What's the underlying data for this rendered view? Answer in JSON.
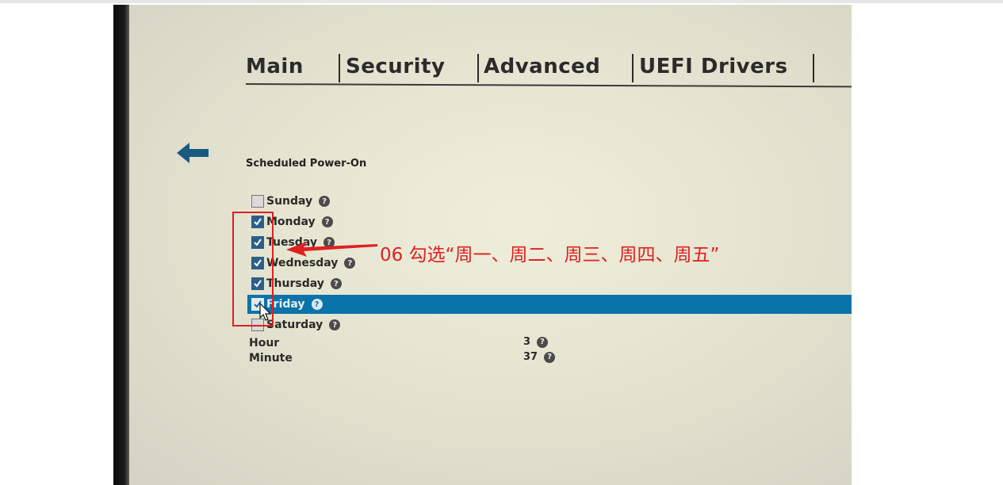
{
  "tabs": [
    {
      "label": "Main"
    },
    {
      "label": "Security"
    },
    {
      "label": "Advanced"
    },
    {
      "label": "UEFI Drivers"
    }
  ],
  "section_title": "Scheduled Power-On",
  "days": [
    {
      "label": "Sunday",
      "checked": false
    },
    {
      "label": "Monday",
      "checked": true
    },
    {
      "label": "Tuesday",
      "checked": true
    },
    {
      "label": "Wednesday",
      "checked": true
    },
    {
      "label": "Thursday",
      "checked": true
    },
    {
      "label": "Friday",
      "checked": true,
      "selected": true
    },
    {
      "label": "Saturday",
      "checked": false
    }
  ],
  "fields": {
    "hour": {
      "label": "Hour",
      "value": "3"
    },
    "minute": {
      "label": "Minute",
      "value": "37"
    }
  },
  "annotation": {
    "text": "06 勾选“周一、周二、周三、周四、周五”",
    "color": "#e02020"
  },
  "colors": {
    "highlight": "#0a73a9",
    "accent_arrow": "#1a5a80"
  },
  "icons": {
    "back": "back-arrow-icon",
    "help": "help-icon",
    "check": "checkmark-icon",
    "cursor": "mouse-cursor-icon"
  }
}
